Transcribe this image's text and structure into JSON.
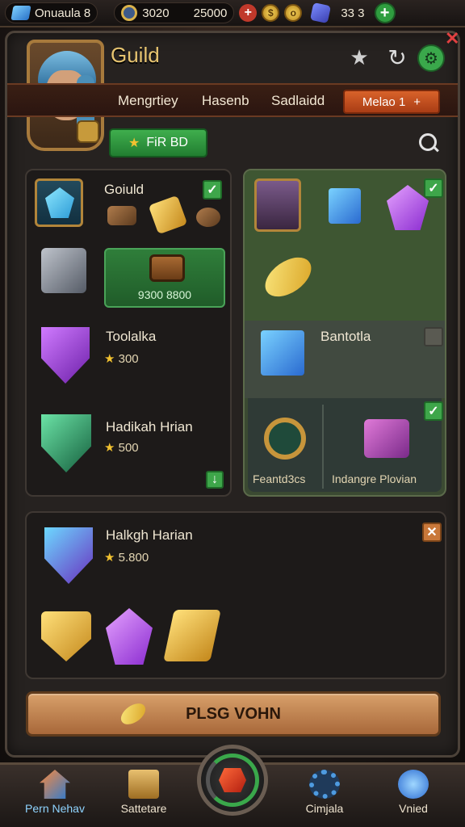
{
  "topbar": {
    "player_label": "Onuaula 8",
    "timer_value": "3020",
    "gold_value": "25000",
    "dice_value": "33 3"
  },
  "header": {
    "title": "Guild",
    "tabs": [
      "Mengrtiey",
      "Hasenb",
      "Sadlaidd"
    ],
    "active_tab": "Melao 1",
    "green_pill": "FiR BD"
  },
  "left_card": {
    "title": "Goiuld",
    "green_box_text": "9300 8800",
    "items": [
      {
        "name": "Toolalka",
        "stars": "300"
      },
      {
        "name": "Hadikah Hrian",
        "stars": "500"
      }
    ]
  },
  "right_card": {
    "mid_label": "Bantotla",
    "bottom_left": "Feantd3cs",
    "bottom_right": "Indangre Plovian"
  },
  "bottom_card": {
    "name": "Halkgh Harian",
    "stars": "5.800"
  },
  "cta": {
    "label": "PLSG VOHN"
  },
  "nav": {
    "items": [
      "Pern Nehav",
      "Sattetare",
      "Cimjala",
      "Vnied"
    ]
  },
  "colors": {
    "accent_orange": "#c9582a",
    "accent_green": "#3aa84b",
    "gold_text": "#e7c470"
  }
}
